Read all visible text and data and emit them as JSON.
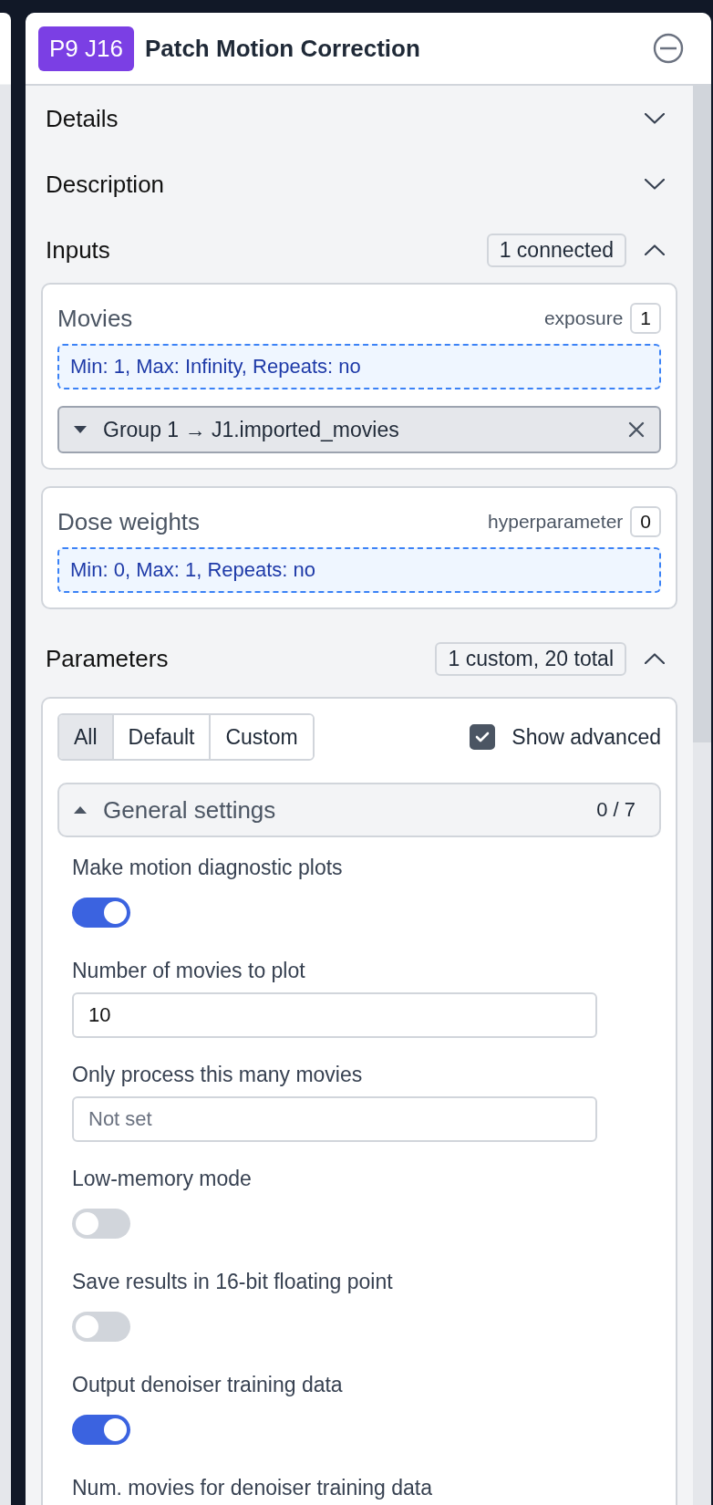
{
  "job": {
    "badge": "P9 J16",
    "title": "Patch Motion Correction"
  },
  "sections": [
    {
      "title": "Details",
      "expanded": false
    },
    {
      "title": "Description",
      "expanded": false
    },
    {
      "kind": "inputs",
      "title": "Inputs",
      "expanded": true,
      "summary": "1 connected",
      "slots": [
        {
          "name": "Movies",
          "type": "exposure",
          "count": "1",
          "constraint": "Min: 1, Max: Infinity, Repeats: no",
          "connections": [
            {
              "label": "Group 1 → J1.imported_movies"
            }
          ]
        },
        {
          "name": "Dose weights",
          "type": "hyperparameter",
          "count": "0",
          "constraint": "Min: 0, Max: 1, Repeats: no"
        }
      ]
    },
    {
      "kind": "parameters",
      "title": "Parameters",
      "expanded": true,
      "summary": "1 custom, 20 total",
      "filters": [
        {
          "label": "All",
          "selected": true
        },
        {
          "label": "Default",
          "selected": false
        },
        {
          "label": "Custom",
          "selected": false
        }
      ],
      "show_advanced": {
        "label": "Show advanced",
        "checked": true
      },
      "groups": [
        {
          "title": "General settings",
          "expanded": true,
          "count": "0 / 7",
          "params": [
            {
              "kind": "toggle",
              "label": "Make motion diagnostic plots",
              "on": true
            },
            {
              "kind": "number",
              "label": "Number of movies to plot",
              "value": "10"
            },
            {
              "kind": "number",
              "label": "Only process this many movies",
              "placeholder": "Not set"
            },
            {
              "kind": "toggle",
              "label": "Low-memory mode",
              "on": false
            },
            {
              "kind": "toggle",
              "label": "Save results in 16-bit floating point",
              "on": false
            },
            {
              "kind": "toggle",
              "label": "Output denoiser training data",
              "on": true
            },
            {
              "kind": "label",
              "label": "Num. movies for denoiser training data"
            }
          ]
        }
      ]
    }
  ]
}
